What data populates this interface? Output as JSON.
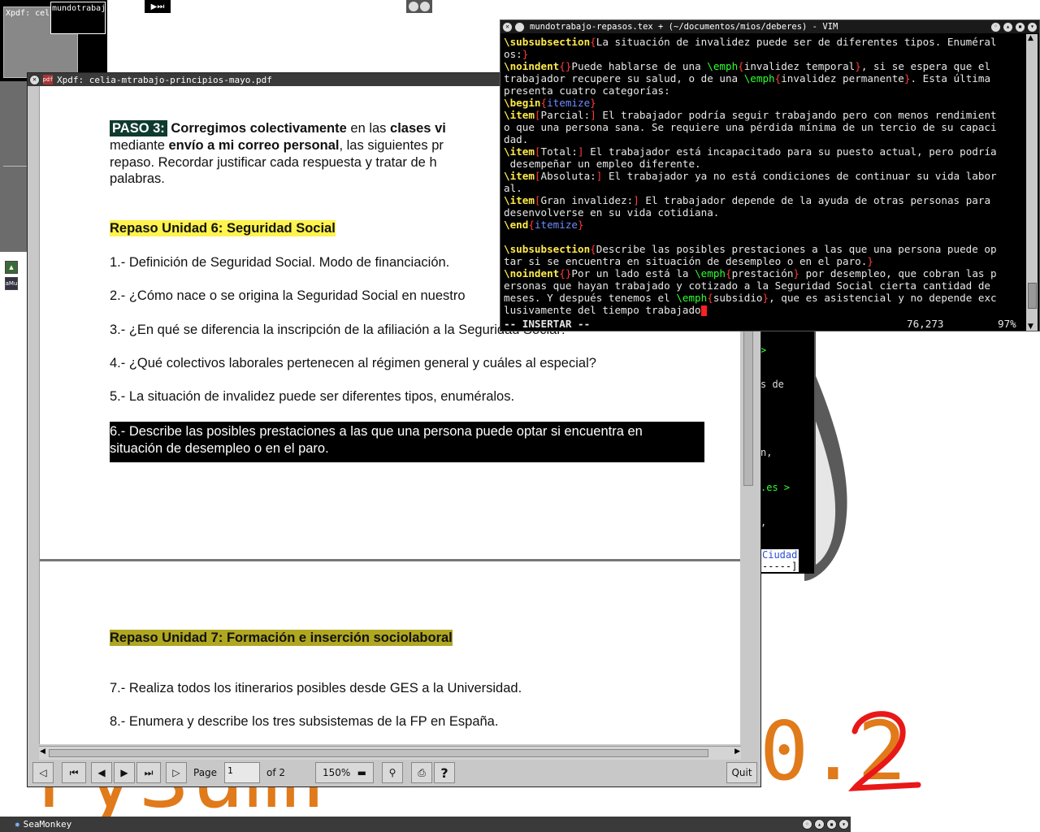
{
  "desktop": {
    "pager": {
      "desk1_label": "Xpdf: cel",
      "desk2_label": "mundotrabaj"
    },
    "dock_icons": [
      "play-icon",
      "orbs-icon"
    ],
    "tray_label": "aMu",
    "big_left_text": "ryзumг",
    "big_right_text": "0.2",
    "term_fragments": [
      ">",
      "s de",
      "n,",
      ".es >",
      ",",
      "Ciudad",
      "-----]"
    ]
  },
  "xpdf": {
    "title": "Xpdf: celia-mtrabajo-principios-mayo.pdf",
    "paso_label": "PASO 3:",
    "line1_bold": "Corregimos colectivamente",
    "line1_mid": " en las ",
    "line1_bold2": "clases vi",
    "line2_a": "mediante ",
    "line2_bold": "envío a mi correo personal",
    "line2_b": ", las siguientes pr",
    "line3": "repaso. Recordar justificar cada respuesta y tratar de h",
    "line4": "palabras.",
    "unit6_heading": "Repaso Unidad 6: Seguridad Social",
    "q1": "1.- Definición de Seguridad Social. Modo de financiación.",
    "q2": "2.- ¿Cómo nace o se origina la Seguridad Social en nuestro",
    "q3": "3.- ¿En qué se diferencia la  inscripción de la afiliación a la Seguridad Social?",
    "q4": "4.- ¿Qué colectivos laborales pertenecen al régimen general y cuáles al especial?",
    "q5": "5.- La situación de invalidez puede ser diferentes tipos, enuméralos.",
    "q6_line1": "6.- Describe las posibles prestaciones a las que una persona puede optar si encuentra en",
    "q6_line2": "situación de desempleo o en el paro.",
    "unit7_heading": "Repaso Unidad 7: Formación  e inserción sociolaboral",
    "q7": "7.- Realiza todos los itinerarios posibles desde GES a la Universidad.",
    "q8": "8.- Enumera y describe los tres subsistemas de la FP en España.",
    "toolbar": {
      "page_label": "Page",
      "page_value": "1",
      "of_label": "of 2",
      "zoom_value": "150%",
      "help_label": "?",
      "quit_label": "Quit"
    }
  },
  "vim": {
    "title": "mundotrabajo-repasos.tex + (~/documentos/mios/deberes) - VIM",
    "mode": "-- INSERTAR --",
    "position": "76,273",
    "percent": "97%",
    "lines": {
      "l01a": "\\subsubsection",
      "l01b": "{",
      "l01c": "La situación de invalidez puede ser de diferentes tipos. Enuméral",
      "l02a": "os:",
      "l02b": "}",
      "l03a": "\\noindent",
      "l03b": "{}",
      "l03c": "Puede hablarse de una ",
      "l03d": "\\emph",
      "l03e": "{",
      "l03f": "invalidez temporal",
      "l03g": "}",
      "l03h": ", si se espera que el",
      "l04a": "trabajador recupere su salud, o de una ",
      "l04b": "\\emph",
      "l04c": "{",
      "l04d": "invalidez permanente",
      "l04e": "}",
      "l04f": ". Esta última",
      "l05": "presenta cuatro categorías:",
      "l06a": "\\begin",
      "l06b": "{",
      "l06c": "itemize",
      "l06d": "}",
      "l07a": "\\item",
      "l07b": "[",
      "l07c": "Parcial:",
      "l07d": "]",
      "l07e": " El trabajador podría seguir trabajando pero con menos rendimient",
      "l08": "o que una persona sana. Se requiere una pérdida mínima de un tercio de su capaci",
      "l09": "dad.",
      "l10a": "\\item",
      "l10b": "[",
      "l10c": "Total:",
      "l10d": "]",
      "l10e": " El trabajador está incapacitado para su puesto actual, pero podría",
      "l11": " desempeñar un empleo diferente.",
      "l12a": "\\item",
      "l12b": "[",
      "l12c": "Absoluta:",
      "l12d": "]",
      "l12e": " El trabajador ya no está condiciones de continuar su vida labor",
      "l13": "al.",
      "l14a": "\\item",
      "l14b": "[",
      "l14c": "Gran invalidez:",
      "l14d": "]",
      "l14e": " El trabajador depende de la ayuda de otras personas para",
      "l15": "desenvolverse en su vida cotidiana.",
      "l16a": "\\end",
      "l16b": "{",
      "l16c": "itemize",
      "l16d": "}",
      "l18a": "\\subsubsection",
      "l18b": "{",
      "l18c": "Describe las posibles prestaciones a las que una persona puede op",
      "l19a": "tar si se encuentra en situación de desempleo o en el paro.",
      "l19b": "}",
      "l20a": "\\noindent",
      "l20b": "{}",
      "l20c": "Por un lado está la ",
      "l20d": "\\emph",
      "l20e": "{",
      "l20f": "prestación",
      "l20g": "}",
      "l20h": " por desempleo, que cobran las p",
      "l21": "ersonas que hayan trabajado y cotizado a la Seguridad Social cierta cantidad de",
      "l22a": "meses. Y después tenemos el ",
      "l22b": "\\emph",
      "l22c": "{",
      "l22d": "subsidio",
      "l22e": "}",
      "l22f": ", que es asistencial y no depende exc",
      "l23": "lusivamente del tiempo trabajado"
    }
  },
  "taskbar": {
    "item_label": "SeaMonkey"
  }
}
